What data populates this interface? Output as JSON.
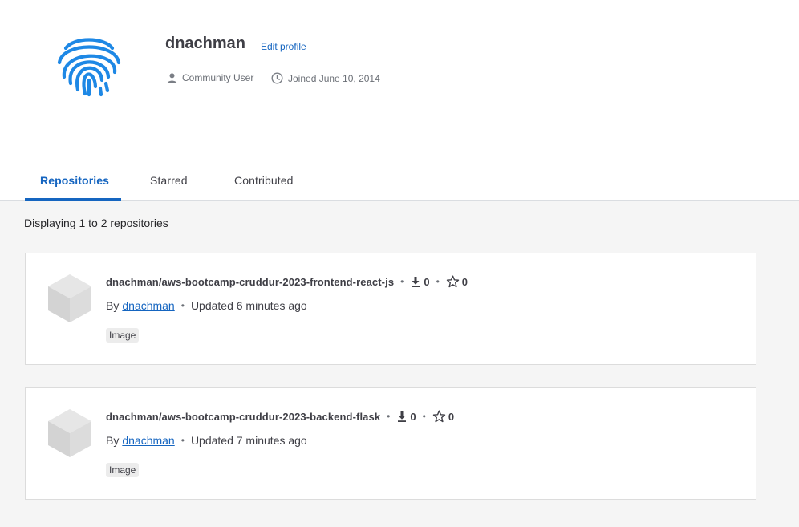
{
  "profile": {
    "username": "dnachman",
    "edit_label": "Edit profile",
    "role": "Community User",
    "joined": "Joined June 10, 2014",
    "avatar_icon": "fingerprint-icon",
    "accent": "#1e88e5"
  },
  "tabs": [
    {
      "label": "Repositories",
      "active": true
    },
    {
      "label": "Starred",
      "active": false
    },
    {
      "label": "Contributed",
      "active": false
    }
  ],
  "list": {
    "count_text": "Displaying 1 to 2 repositories",
    "repos": [
      {
        "name": "dnachman/aws-bootcamp-cruddur-2023-frontend-react-js",
        "downloads": "0",
        "stars": "0",
        "by_label": "By",
        "owner": "dnachman",
        "updated": "Updated 6 minutes ago",
        "badge": "Image"
      },
      {
        "name": "dnachman/aws-bootcamp-cruddur-2023-backend-flask",
        "downloads": "0",
        "stars": "0",
        "by_label": "By",
        "owner": "dnachman",
        "updated": "Updated 7 minutes ago",
        "badge": "Image"
      }
    ]
  }
}
